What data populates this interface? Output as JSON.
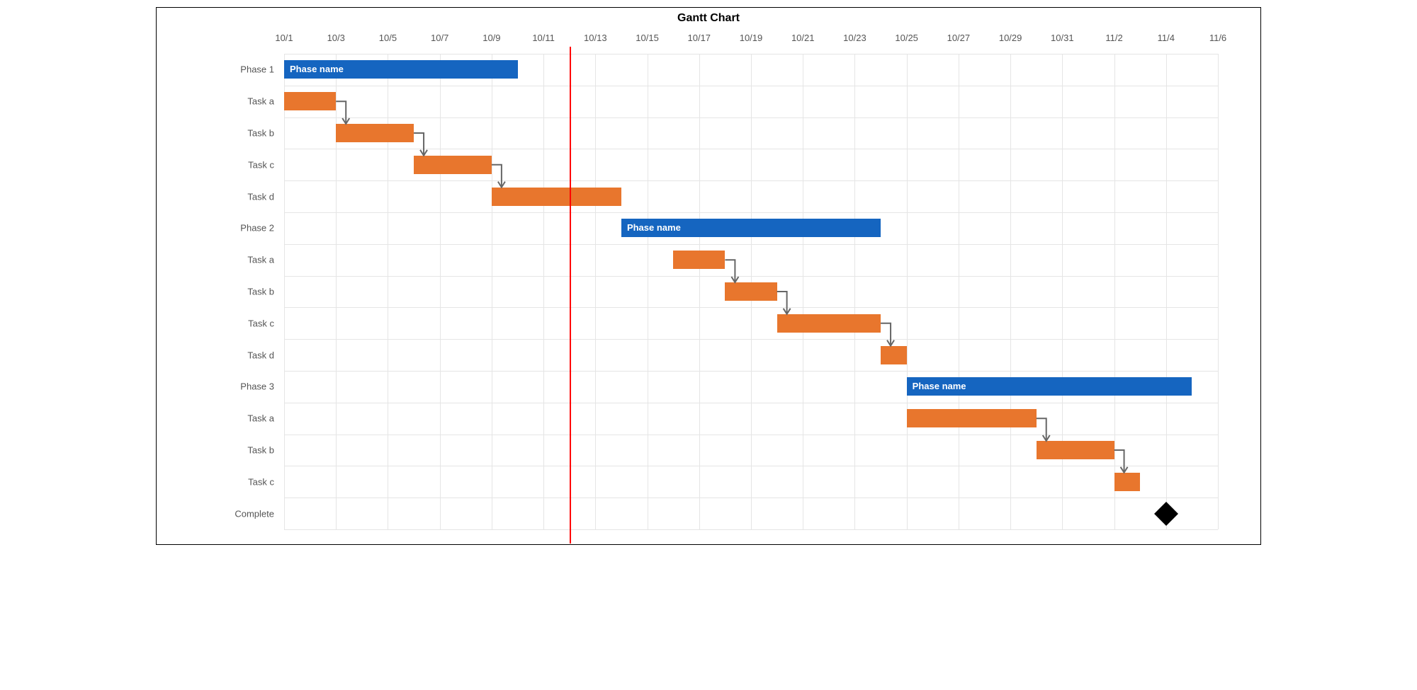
{
  "chart_data": {
    "type": "gantt",
    "title": "Gantt Chart",
    "x_axis": {
      "ticks": [
        "10/1",
        "10/3",
        "10/5",
        "10/7",
        "10/9",
        "10/11",
        "10/13",
        "10/15",
        "10/17",
        "10/19",
        "10/21",
        "10/23",
        "10/25",
        "10/27",
        "10/29",
        "10/31",
        "11/2",
        "11/4",
        "11/6"
      ],
      "range_days": [
        0,
        36
      ]
    },
    "today_marker_day": 11,
    "rows": [
      {
        "id": "phase1",
        "label": "Phase 1",
        "type": "phase",
        "bar_label": "Phase name",
        "start": 0,
        "end": 9
      },
      {
        "id": "p1-task-a",
        "label": "Task a",
        "type": "task",
        "start": 0,
        "end": 2,
        "dep_to": "p1-task-b"
      },
      {
        "id": "p1-task-b",
        "label": "Task b",
        "type": "task",
        "start": 2,
        "end": 5,
        "dep_to": "p1-task-c"
      },
      {
        "id": "p1-task-c",
        "label": "Task c",
        "type": "task",
        "start": 5,
        "end": 8,
        "dep_to": "p1-task-d"
      },
      {
        "id": "p1-task-d",
        "label": "Task d",
        "type": "task",
        "start": 8,
        "end": 13
      },
      {
        "id": "phase2",
        "label": "Phase 2",
        "type": "phase",
        "bar_label": "Phase name",
        "start": 13,
        "end": 23
      },
      {
        "id": "p2-task-a",
        "label": "Task a",
        "type": "task",
        "start": 15,
        "end": 17,
        "dep_to": "p2-task-b"
      },
      {
        "id": "p2-task-b",
        "label": "Task b",
        "type": "task",
        "start": 17,
        "end": 19,
        "dep_to": "p2-task-c"
      },
      {
        "id": "p2-task-c",
        "label": "Task c",
        "type": "task",
        "start": 19,
        "end": 23,
        "dep_to": "p2-task-d"
      },
      {
        "id": "p2-task-d",
        "label": "Task d",
        "type": "task",
        "start": 23,
        "end": 24
      },
      {
        "id": "phase3",
        "label": "Phase 3",
        "type": "phase",
        "bar_label": "Phase name",
        "start": 24,
        "end": 35
      },
      {
        "id": "p3-task-a",
        "label": "Task a",
        "type": "task",
        "start": 24,
        "end": 29,
        "dep_to": "p3-task-b"
      },
      {
        "id": "p3-task-b",
        "label": "Task b",
        "type": "task",
        "start": 29,
        "end": 32,
        "dep_to": "p3-task-c"
      },
      {
        "id": "p3-task-c",
        "label": "Task c",
        "type": "task",
        "start": 32,
        "end": 33
      },
      {
        "id": "complete",
        "label": "Complete",
        "type": "milestone",
        "start": 34,
        "end": 34
      }
    ],
    "colors": {
      "phase": "#1565c0",
      "task": "#e8762d",
      "today_line": "#ff0000",
      "milestone": "#000000"
    }
  }
}
